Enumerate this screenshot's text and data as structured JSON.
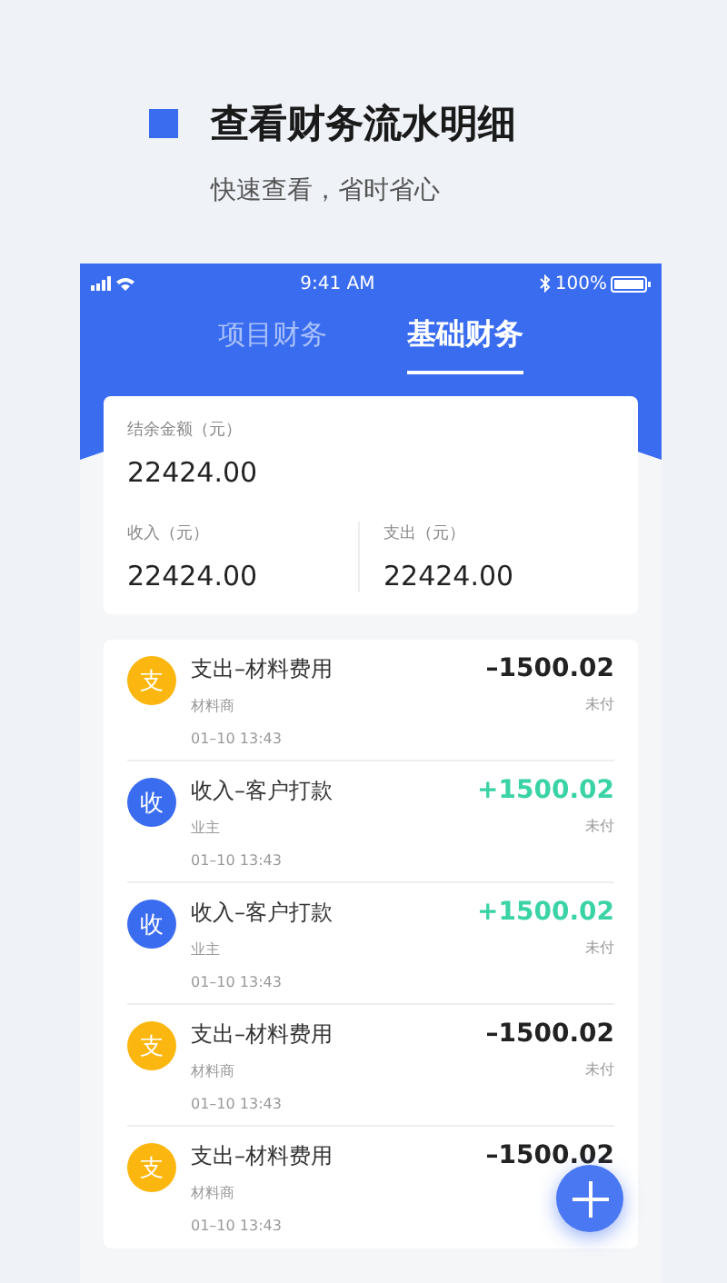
{
  "header": {
    "title": "查看财务流水明细",
    "subtitle": "快速查看，省时省心"
  },
  "status_bar": {
    "time": "9:41 AM",
    "battery": "100%"
  },
  "tabs": [
    {
      "label": "项目财务",
      "selected": false
    },
    {
      "label": "基础财务",
      "selected": true
    }
  ],
  "summary": {
    "balance_label": "结余金额（元）",
    "balance": "22424.00",
    "income_label": "收入（元）",
    "income": "22424.00",
    "expense_label": "支出（元）",
    "expense": "22424.00"
  },
  "transactions": [
    {
      "kind": "expense",
      "badge": "支",
      "title": "支出–材料费用",
      "party": "材料商",
      "time": "01–10  13:43",
      "amount": "–1500.02",
      "status": "未付"
    },
    {
      "kind": "income",
      "badge": "收",
      "title": "收入–客户打款",
      "party": "业主",
      "time": "01–10  13:43",
      "amount": "+1500.02",
      "status": "未付"
    },
    {
      "kind": "income",
      "badge": "收",
      "title": "收入–客户打款",
      "party": "业主",
      "time": "01–10  13:43",
      "amount": "+1500.02",
      "status": "未付"
    },
    {
      "kind": "expense",
      "badge": "支",
      "title": "支出–材料费用",
      "party": "材料商",
      "time": "01–10  13:43",
      "amount": "–1500.02",
      "status": "未付"
    },
    {
      "kind": "expense",
      "badge": "支",
      "title": "支出–材料费用",
      "party": "材料商",
      "time": "01–10  13:43",
      "amount": "–1500.02"
    }
  ]
}
